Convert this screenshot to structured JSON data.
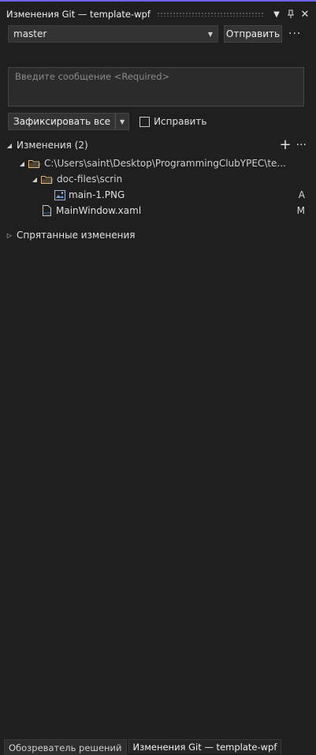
{
  "window": {
    "title": "Изменения Git — template-wpf"
  },
  "toolbar": {
    "branch": "master",
    "push_label": "Отправить",
    "more_label": "···"
  },
  "message": {
    "placeholder": "Введите сообщение <Required>"
  },
  "commit": {
    "commit_all_label": "Зафиксировать все",
    "amend_label": "Исправить"
  },
  "changes": {
    "header": "Изменения (2)",
    "root_path": "C:\\Users\\saint\\Desktop\\ProgrammingClubYPEC\\te...",
    "subfolder": "doc-files\\scrin",
    "files": [
      {
        "name": "main-1.PNG",
        "status": "A"
      },
      {
        "name": "MainWindow.xaml",
        "status": "M"
      }
    ]
  },
  "stashed": {
    "header": "Спрятанные изменения"
  },
  "tabs": [
    {
      "label": "Обозреватель решений"
    },
    {
      "label": "Изменения Git — template-wpf"
    }
  ],
  "colors": {
    "accent": "#7160e8",
    "folder": "#dcb67a",
    "background": "#1f1f1f"
  }
}
